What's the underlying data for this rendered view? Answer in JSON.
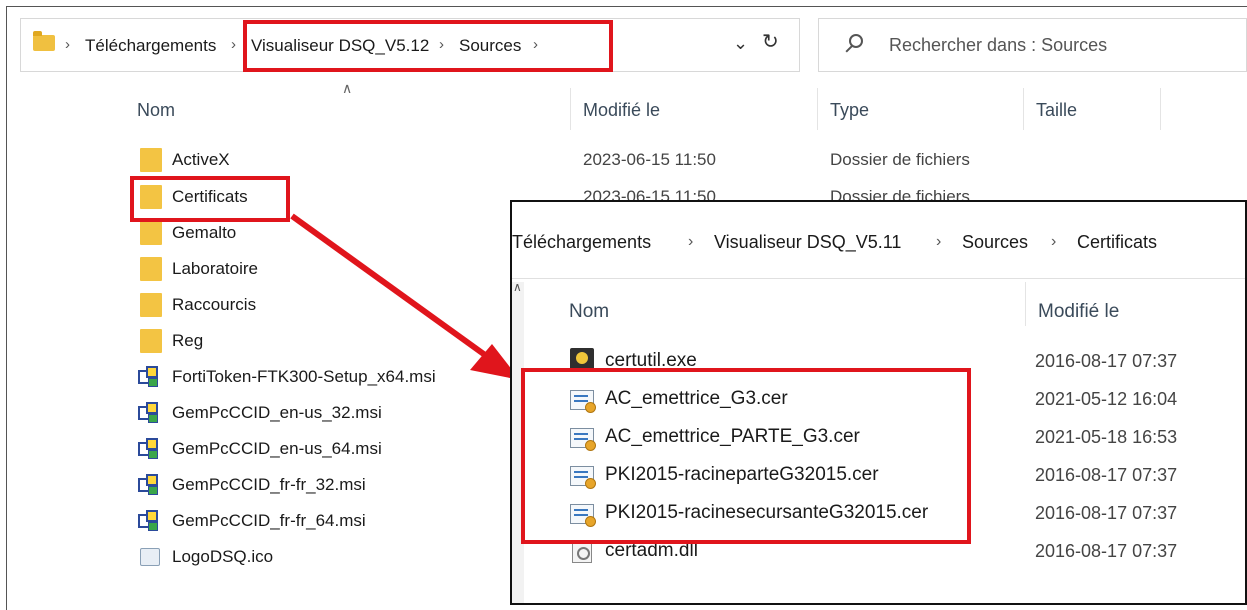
{
  "main_window": {
    "breadcrumb": [
      "Téléchargements",
      "Visualiseur DSQ_V5.12",
      "Sources"
    ],
    "search_placeholder": "Rechercher dans : Sources",
    "columns": {
      "name": "Nom",
      "modified": "Modifié le",
      "type": "Type",
      "size": "Taille"
    },
    "rows": [
      {
        "name": "ActiveX",
        "modified": "2023-06-15 11:50",
        "type": "Dossier de fichiers",
        "icon": "folder-icon"
      },
      {
        "name": "Certificats",
        "modified": "2023-06-15 11:50",
        "type": "Dossier de fichiers",
        "icon": "folder-icon"
      },
      {
        "name": "Gemalto",
        "modified": "",
        "type": "",
        "icon": "folder-icon"
      },
      {
        "name": "Laboratoire",
        "modified": "",
        "type": "",
        "icon": "folder-icon"
      },
      {
        "name": "Raccourcis",
        "modified": "",
        "type": "",
        "icon": "folder-icon"
      },
      {
        "name": "Reg",
        "modified": "",
        "type": "",
        "icon": "folder-icon"
      },
      {
        "name": "FortiToken-FTK300-Setup_x64.msi",
        "modified": "",
        "type": "",
        "icon": "msi-installer-icon"
      },
      {
        "name": "GemPcCCID_en-us_32.msi",
        "modified": "",
        "type": "",
        "icon": "msi-installer-icon"
      },
      {
        "name": "GemPcCCID_en-us_64.msi",
        "modified": "",
        "type": "",
        "icon": "msi-installer-icon"
      },
      {
        "name": "GemPcCCID_fr-fr_32.msi",
        "modified": "",
        "type": "",
        "icon": "msi-installer-icon"
      },
      {
        "name": "GemPcCCID_fr-fr_64.msi",
        "modified": "",
        "type": "",
        "icon": "msi-installer-icon"
      },
      {
        "name": "LogoDSQ.ico",
        "modified": "",
        "type": "",
        "icon": "image-file-icon"
      }
    ]
  },
  "inset_window": {
    "breadcrumb": [
      "Téléchargements",
      "Visualiseur DSQ_V5.11",
      "Sources",
      "Certificats"
    ],
    "columns": {
      "name": "Nom",
      "modified": "Modifié le"
    },
    "rows": [
      {
        "name": "certutil.exe",
        "modified": "2016-08-17 07:37",
        "icon": "exe-icon"
      },
      {
        "name": "AC_emettrice_G3.cer",
        "modified": "2021-05-12 16:04",
        "icon": "certificate-icon"
      },
      {
        "name": "AC_emettrice_PARTE_G3.cer",
        "modified": "2021-05-18 16:53",
        "icon": "certificate-icon"
      },
      {
        "name": "PKI2015-racineparteG32015.cer",
        "modified": "2016-08-17 07:37",
        "icon": "certificate-icon"
      },
      {
        "name": "PKI2015-racinesecursanteG32015.cer",
        "modified": "2016-08-17 07:37",
        "icon": "certificate-icon"
      },
      {
        "name": "certadm.dll",
        "modified": "2016-08-17 07:37",
        "icon": "dll-icon"
      }
    ]
  },
  "annotations": {
    "highlight_color": "#e0151c"
  }
}
